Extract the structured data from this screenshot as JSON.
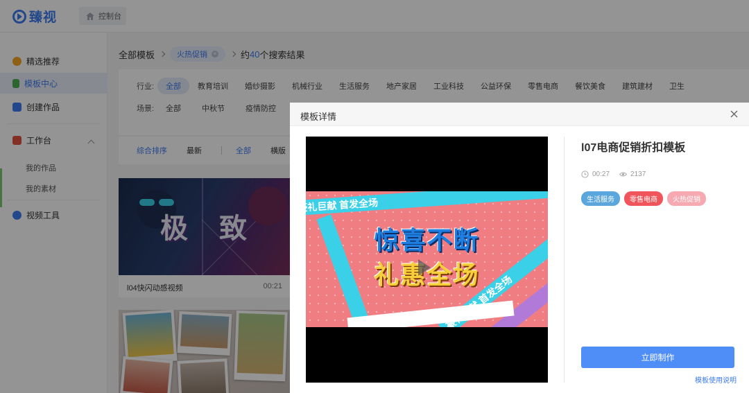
{
  "app": {
    "logo_text": "臻视"
  },
  "topbar": {
    "home_label": "控制台"
  },
  "sidebar": {
    "items": [
      {
        "label": "精选推荐"
      },
      {
        "label": "模板中心"
      },
      {
        "label": "创建作品"
      },
      {
        "label": "工作台"
      },
      {
        "label": "视频工具"
      }
    ],
    "sub_items": [
      {
        "label": "我的作品"
      },
      {
        "label": "我的素材"
      }
    ]
  },
  "breadcrumb": {
    "root": "全部模板",
    "tag": "火热促销",
    "result_prefix": "约",
    "result_count": "40",
    "result_suffix": "个搜索结果"
  },
  "filters": {
    "industry_label": "行业:",
    "industry_options": [
      "全部",
      "教育培训",
      "婚纱摄影",
      "机械行业",
      "生活服务",
      "地产家居",
      "工业科技",
      "公益环保",
      "零售电商",
      "餐饮美食",
      "建筑建材",
      "卫生"
    ],
    "scene_label": "场景:",
    "scene_options": [
      "全部",
      "中秋节",
      "疫情防控"
    ]
  },
  "sort": {
    "options": [
      "综合排序",
      "最新"
    ],
    "type_options": [
      "全部",
      "横版"
    ]
  },
  "cards": [
    {
      "title": "l04快闪动感视频",
      "duration": "00:21",
      "thumb_text_a": "极",
      "thumb_text_b": "致"
    }
  ],
  "modal": {
    "title": "模板详情",
    "template_name": "l07电商促销折扣模板",
    "duration": "00:27",
    "views": "2137",
    "tags": [
      {
        "label": "生活服务",
        "color": "#5ba7dd"
      },
      {
        "label": "零售电商",
        "color": "#f0555b"
      },
      {
        "label": "火热促销",
        "color": "#f6a9b1"
      }
    ],
    "video": {
      "headline_1": "惊喜不断",
      "headline_2": "礼惠全场",
      "ribbon_text": "豪礼巨献 首发全场"
    },
    "make_button": "立即制作",
    "help_link": "模板使用说明"
  },
  "colors": {
    "accent": "#3d7bf0",
    "button": "#4f8ef7"
  }
}
